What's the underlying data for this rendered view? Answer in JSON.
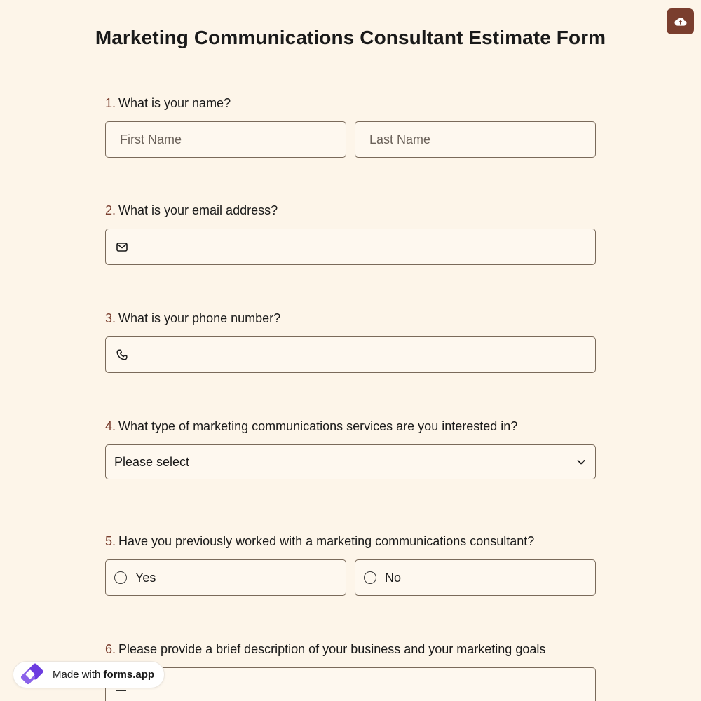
{
  "form": {
    "title": "Marketing Communications Consultant Estimate Form"
  },
  "toolbar": {
    "upload_icon": "cloud-upload-icon",
    "accent_color": "#7a3e2e"
  },
  "questions": [
    {
      "num": "1.",
      "label": "What is your name?",
      "first_placeholder": "First Name",
      "last_placeholder": "Last Name"
    },
    {
      "num": "2.",
      "label": "What is your email address?",
      "icon": "mail-icon",
      "value": ""
    },
    {
      "num": "3.",
      "label": "What is your phone number?",
      "icon": "phone-icon",
      "value": ""
    },
    {
      "num": "4.",
      "label": "What type of marketing communications services are you interested in?",
      "selected": "Please select"
    },
    {
      "num": "5.",
      "label": "Have you previously worked with a marketing communications consultant?",
      "options": [
        "Yes",
        "No"
      ]
    },
    {
      "num": "6.",
      "label": "Please provide a brief description of your business and your marketing goals",
      "icon": "text-lines-icon"
    }
  ],
  "badge": {
    "prefix": "Made with",
    "brand": "forms.app",
    "icon": "forms-app-logo-icon"
  }
}
